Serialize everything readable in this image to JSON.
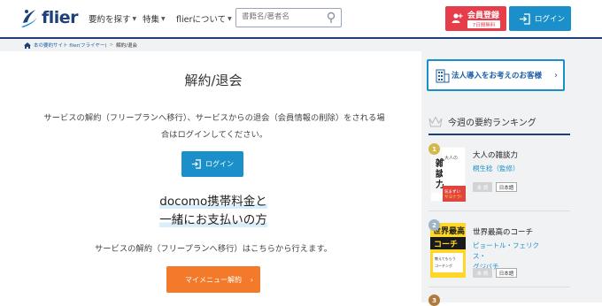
{
  "header": {
    "logo_text": "flier",
    "nav": [
      {
        "label": "要約を探す"
      },
      {
        "label": "特集"
      },
      {
        "label": "flierについて"
      }
    ],
    "search_placeholder": "書籍名/著者名",
    "register_label": "会員登録",
    "register_sub": "7日間無料",
    "login_label": "ログイン"
  },
  "breadcrumb": {
    "home": "本の要約サイト flier(フライヤー)",
    "separator": ">",
    "current": "解約/退会"
  },
  "main": {
    "title": "解約/退会",
    "desc_line1": "サービスの解約（フリープランへ移行）、サービスからの退会（会員情報の削除）をされる場",
    "desc_line2": "合はログインしてください。",
    "login_button": "ログイン",
    "docomo_line1": "docomo携帯料金と",
    "docomo_line2": "一緒にお支払いの方",
    "docomo_desc": "サービスの解約（フリープランへ移行）はこちらから行えます。",
    "menu_button": "マイメニュー解約"
  },
  "sidebar": {
    "corp_label": "法人導入をお考えのお客様",
    "ranking_title": "今週の要約ランキング",
    "books": [
      {
        "rank": "1",
        "title": "大人の雑談力",
        "author": "桐生稔（監修）",
        "tag1": "未 読",
        "tag2": "日本語",
        "cover_text": "大人の雑談力"
      },
      {
        "rank": "2",
        "title": "世界最高のコーチ",
        "author_line1": "ピョートル・フェリクス・",
        "author_line2": "グジバチ",
        "tag1": "未 読",
        "tag2": "日本語",
        "cover_text": "世界最高のコーチ"
      },
      {
        "rank": "3"
      }
    ]
  },
  "colors": {
    "brand_navy": "#1e3f78",
    "login_blue": "#1b8fca",
    "register_red": "#e73d4a",
    "menu_orange": "#f47a2b"
  }
}
